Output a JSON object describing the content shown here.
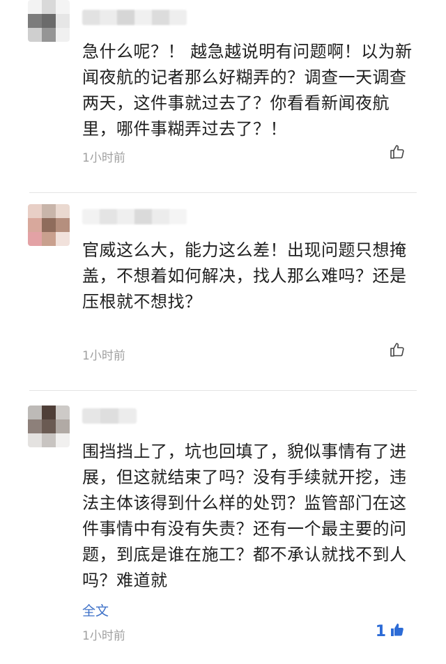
{
  "comments": [
    {
      "text": "急什么呢？！ 越急越说明有问题啊！以为新闻夜航的记者那么好糊弄的？调查一天调查两天，这件事就过去了？你看看新闻夜航里，哪件事糊弄过去了？！",
      "time": "1小时前",
      "likes": "",
      "like_active": false,
      "avatar_colors": [
        "#f3f3f3",
        "#d9d9d9",
        "#f4f4f4",
        "#7c7c7c",
        "#6b6b6b",
        "#e6e6e6",
        "#cfcfcf",
        "#959595",
        "#f0f0f0"
      ],
      "name_colors": [
        "#e2e2e2",
        "#ececec",
        "#d6d6d6",
        "#f0f0f0",
        "#dcdcdc",
        "#eeeeee"
      ]
    },
    {
      "text": "官威这么大，能力这么差！出现问题只想掩盖，不想着如何解决，找人那么难吗？还是压根就不想找？",
      "time": "1小时前",
      "likes": "",
      "like_active": false,
      "avatar_colors": [
        "#e8cfc6",
        "#c8b5aa",
        "#ead9d0",
        "#d8a89c",
        "#8f6c5c",
        "#b58f7e",
        "#e3a2a5",
        "#c9a08e",
        "#f1e1db"
      ],
      "name_colors": [
        "#f2f2f2",
        "#e4e4e4",
        "#efefef",
        "#dadada",
        "#ececec",
        "#f4f4f4"
      ]
    },
    {
      "text": "围挡挡上了，坑也回填了，貌似事情有了进展，但这就结束了吗？没有手续就开挖，违法主体该得到什么样的处罚？监管部门在这件事情中有没有失责？还有一个最主要的问题，到底是谁在施工？都不承认就找不到人吗？难道就",
      "full_text_label": "全文",
      "time": "1小时前",
      "likes": "1",
      "like_active": true,
      "avatar_colors": [
        "#bdbab7",
        "#4f3f38",
        "#cdcac7",
        "#8d807a",
        "#6a5a52",
        "#b1aaa5",
        "#e4e2e0",
        "#c8c4c1",
        "#f1f0ef"
      ],
      "name_colors": [
        "#e6e6e6",
        "#dedede",
        "#ececec"
      ]
    }
  ],
  "colors": {
    "accent": "#3f72c8",
    "like_active": "#2c6bd6",
    "muted_text": "#a0a0a0",
    "divider": "#e4e4e4"
  }
}
